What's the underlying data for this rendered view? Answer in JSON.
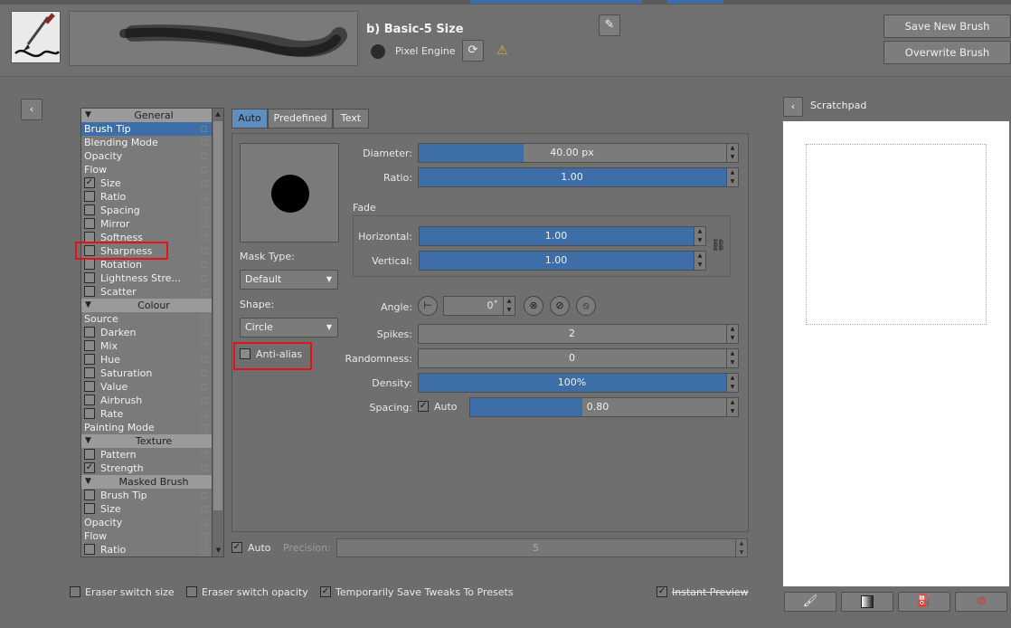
{
  "header": {
    "preset_title": "b) Basic-5 Size",
    "engine_label": "Pixel Engine",
    "save_new_preset_label": "Save New Brush Preset...",
    "overwrite_brush_label": "Overwrite Brush",
    "edit_icon": "pencil-icon",
    "reload_icon": "reload-icon",
    "warning_icon": "warning-icon"
  },
  "options_list": {
    "items": [
      {
        "type": "header",
        "label": "General"
      },
      {
        "type": "item",
        "label": "Brush Tip",
        "selected": true
      },
      {
        "type": "item",
        "label": "Blending Mode"
      },
      {
        "type": "item",
        "label": "Opacity"
      },
      {
        "type": "item",
        "label": "Flow"
      },
      {
        "type": "check",
        "label": "Size",
        "checked": true
      },
      {
        "type": "check",
        "label": "Ratio",
        "checked": false
      },
      {
        "type": "check",
        "label": "Spacing",
        "checked": false
      },
      {
        "type": "check",
        "label": "Mirror",
        "checked": false
      },
      {
        "type": "check",
        "label": "Softness",
        "checked": false
      },
      {
        "type": "check",
        "label": "Sharpness",
        "checked": false
      },
      {
        "type": "check",
        "label": "Rotation",
        "checked": false
      },
      {
        "type": "check",
        "label": "Lightness Stre...",
        "checked": false
      },
      {
        "type": "check",
        "label": "Scatter",
        "checked": false
      },
      {
        "type": "header",
        "label": "Colour"
      },
      {
        "type": "item",
        "label": "Source"
      },
      {
        "type": "check",
        "label": "Darken",
        "checked": false
      },
      {
        "type": "check",
        "label": "Mix",
        "checked": false
      },
      {
        "type": "check",
        "label": "Hue",
        "checked": false
      },
      {
        "type": "check",
        "label": "Saturation",
        "checked": false
      },
      {
        "type": "check",
        "label": "Value",
        "checked": false
      },
      {
        "type": "check",
        "label": "Airbrush",
        "checked": false
      },
      {
        "type": "check",
        "label": "Rate",
        "checked": false
      },
      {
        "type": "item",
        "label": "Painting Mode"
      },
      {
        "type": "header",
        "label": "Texture"
      },
      {
        "type": "check",
        "label": "Pattern",
        "checked": false
      },
      {
        "type": "check",
        "label": "Strength",
        "checked": true
      },
      {
        "type": "header",
        "label": "Masked Brush"
      },
      {
        "type": "check",
        "label": "Brush Tip",
        "checked": false
      },
      {
        "type": "check",
        "label": "Size",
        "checked": false
      },
      {
        "type": "item",
        "label": "Opacity"
      },
      {
        "type": "item",
        "label": "Flow"
      },
      {
        "type": "check",
        "label": "Ratio",
        "checked": false
      }
    ]
  },
  "tabs": [
    {
      "label": "Auto",
      "active": true
    },
    {
      "label": "Predefined",
      "active": false
    },
    {
      "label": "Text",
      "active": false
    }
  ],
  "brush_tip": {
    "mask_type_label": "Mask Type:",
    "mask_type_value": "Default",
    "shape_label": "Shape:",
    "shape_value": "Circle",
    "anti_alias_label": "Anti-alias",
    "anti_alias_checked": false,
    "diameter_label": "Diameter:",
    "diameter_value": "40.00 px",
    "diameter_fraction": 0.33,
    "ratio_label": "Ratio:",
    "ratio_value": "1.00",
    "ratio_fraction": 1.0,
    "fade_label": "Fade",
    "horizontal_label": "Horizontal:",
    "horizontal_value": "1.00",
    "vertical_label": "Vertical:",
    "vertical_value": "1.00",
    "angle_label": "Angle:",
    "angle_value": "0˚",
    "spikes_label": "Spikes:",
    "spikes_value": "2",
    "randomness_label": "Randomness:",
    "randomness_value": "0",
    "density_label": "Density:",
    "density_value": "100%",
    "spacing_label": "Spacing:",
    "spacing_auto_label": "Auto",
    "spacing_auto_checked": true,
    "spacing_value": "0.80",
    "spacing_fraction": 0.42,
    "precision_auto_label": "Auto",
    "precision_label": "Precision:",
    "precision_value": "5"
  },
  "scratchpad": {
    "title": "Scratchpad"
  },
  "bottom": {
    "eraser_size_label": "Eraser switch size",
    "eraser_opacity_label": "Eraser switch opacity",
    "temp_save_label": "Temporarily Save Tweaks To Presets",
    "instant_preview_label": "Instant Preview"
  },
  "colors": {
    "accent": "#3d6ea8",
    "highlight_box": "#e8101a",
    "panel_bg": "#6d6d6d"
  }
}
